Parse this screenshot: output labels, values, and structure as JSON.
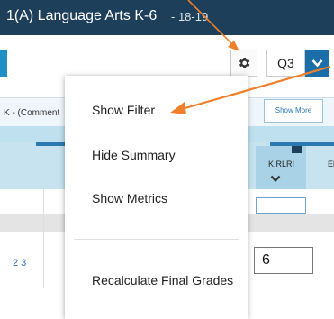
{
  "header": {
    "title": "1(A) Language Arts K-6",
    "subtitle": "- 18-19"
  },
  "toolbar": {
    "quarter_value": "Q3",
    "gear_icon": "gear-icon",
    "dropdown_icon": "chevron-down-icon"
  },
  "section": {
    "partial_label": "K - (Comment",
    "show_more_label": "Show More"
  },
  "grid": {
    "column_label": "K.RLRI",
    "column_label_next": "El",
    "pages": "2   3",
    "grade_value": "6"
  },
  "menu": {
    "items": [
      {
        "label": "Show Filter"
      },
      {
        "label": "Hide Summary"
      },
      {
        "label": "Show Metrics"
      },
      {
        "label": "Recalculate Final Grades"
      }
    ]
  },
  "colors": {
    "titlebar": "#1d3f5a",
    "accent": "#1a6fa8",
    "annotation_arrow": "#f07f2a"
  }
}
